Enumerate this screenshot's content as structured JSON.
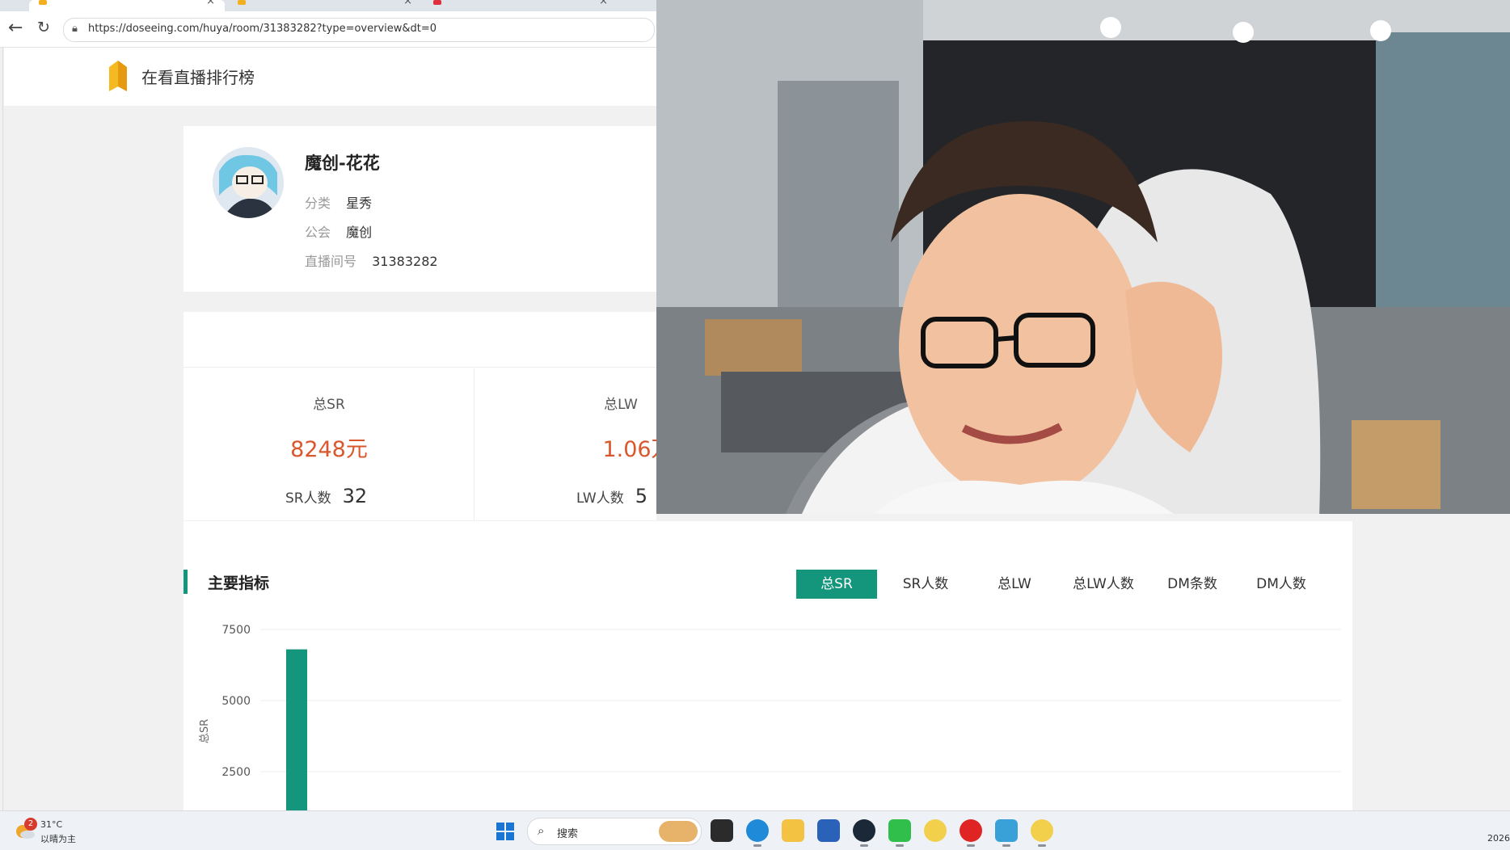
{
  "browser": {
    "url": "https://doseeing.com/huya/room/31383282?type=overview&dt=0"
  },
  "header": {
    "title": "在看直播排行榜"
  },
  "profile": {
    "name": "魔创-花花",
    "category_label": "分类",
    "category_value": "星秀",
    "guild_label": "公会",
    "guild_value": "魔创",
    "room_label": "直播间号",
    "room_value": "31383282"
  },
  "stats": {
    "sr_label": "总SR",
    "sr_value": "8248元",
    "sr_count_label": "SR人数",
    "sr_count_value": "32",
    "lw_label": "总LW",
    "lw_value": "1.06万",
    "lw_count_label": "LW人数",
    "lw_count_value": "5"
  },
  "metrics": {
    "section_title": "主要指标",
    "tabs": [
      "总SR",
      "SR人数",
      "总LW",
      "总LW人数",
      "DM条数",
      "DM人数"
    ],
    "active_tab": "总SR"
  },
  "chart_data": {
    "type": "bar",
    "ylabel": "总SR",
    "yticks": [
      2500,
      5000,
      7500
    ],
    "ylim": [
      0,
      7500
    ],
    "values": [
      6800,
      110
    ],
    "grid": true,
    "color": "#14967c"
  },
  "taskbar": {
    "weather_badge": "2",
    "weather_temp": "31°C",
    "weather_desc": "以晴为主",
    "search_text": "搜索",
    "clock_partial": "2026"
  },
  "colors": {
    "accent": "#14967c",
    "value_red": "#d9572d"
  }
}
